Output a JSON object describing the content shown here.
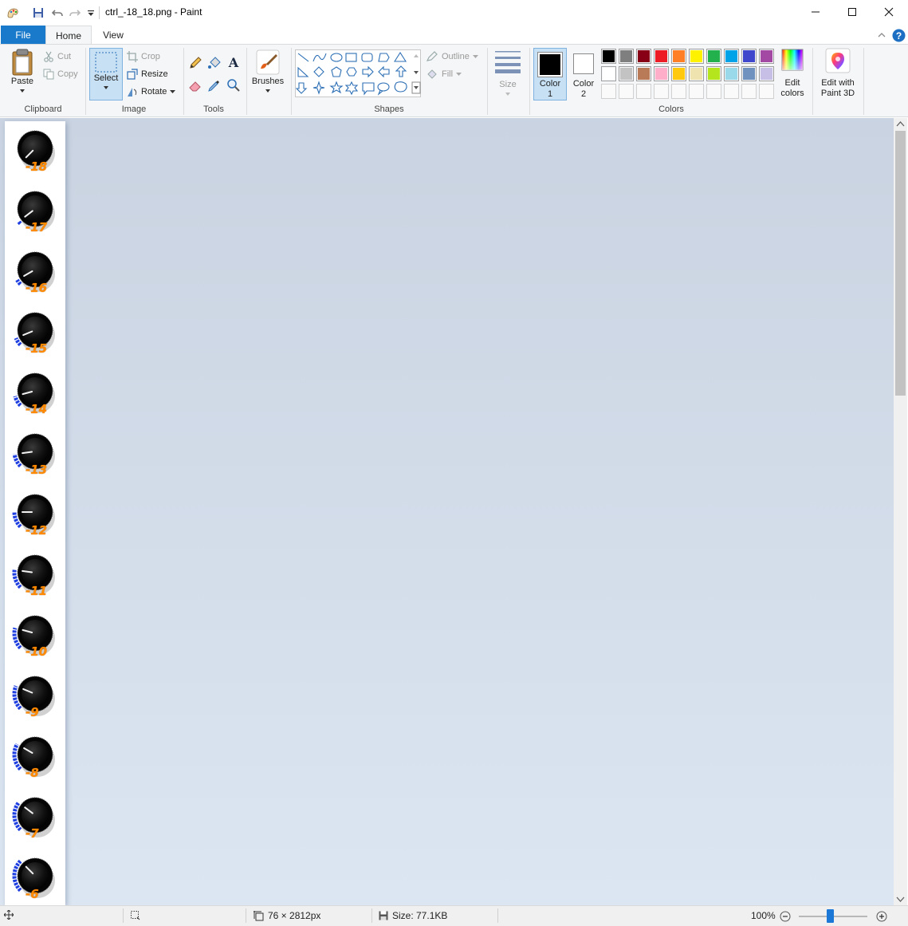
{
  "window": {
    "title": "ctrl_-18_18.png - Paint",
    "minimize_glyph": "—",
    "maximize_glyph": "☐",
    "close_glyph": "✕"
  },
  "tabs": {
    "file": "File",
    "home": "Home",
    "view": "View"
  },
  "ribbon": {
    "clipboard": {
      "label": "Clipboard",
      "paste": "Paste",
      "cut": "Cut",
      "copy": "Copy"
    },
    "image": {
      "label": "Image",
      "select": "Select",
      "crop": "Crop",
      "resize": "Resize",
      "rotate": "Rotate"
    },
    "tools": {
      "label": "Tools"
    },
    "brushes": {
      "label": "Brushes"
    },
    "shapes": {
      "label": "Shapes",
      "outline": "Outline",
      "fill": "Fill"
    },
    "size": {
      "label": "Size"
    },
    "colors": {
      "label": "Colors",
      "color1_label": "Color",
      "color1_num": "1",
      "color2_label": "Color",
      "color2_num": "2",
      "color1_value": "#000000",
      "color2_value": "#ffffff",
      "edit_colors_1": "Edit",
      "edit_colors_2": "colors",
      "palette_row1": [
        "#000000",
        "#7f7f7f",
        "#880015",
        "#ed1c24",
        "#ff7f27",
        "#fff200",
        "#22b14c",
        "#00a2e8",
        "#3f48cc",
        "#a349a4"
      ],
      "palette_row2": [
        "#ffffff",
        "#c3c3c3",
        "#b97a57",
        "#ffaec9",
        "#ffc90e",
        "#efe4b0",
        "#b5e61d",
        "#99d9ea",
        "#7092be",
        "#c8bfe7"
      ]
    },
    "paint3d": {
      "line1": "Edit with",
      "line2": "Paint 3D"
    }
  },
  "canvas": {
    "knob_labels": [
      "-18",
      "-17",
      "-16",
      "-15",
      "-14",
      "-13",
      "-12",
      "-11",
      "-10",
      "-9",
      "-8",
      "-7",
      "-6"
    ]
  },
  "statusbar": {
    "dimensions": "76 × 2812px",
    "size": "Size: 77.1KB",
    "zoom": "100%",
    "zoom_fraction": 0.45
  }
}
